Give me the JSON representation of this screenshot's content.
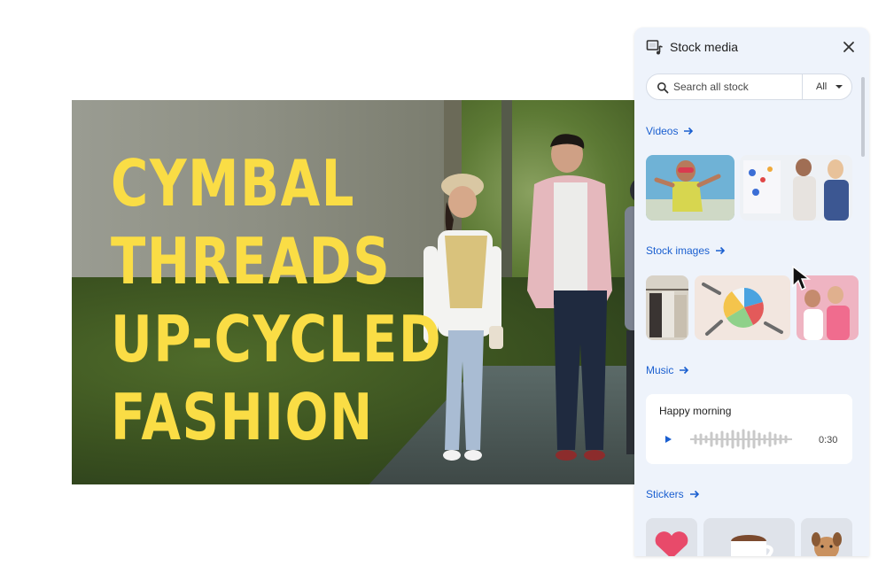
{
  "hero": {
    "title_lines": [
      "CYMBAL",
      "THREADS",
      "UP-CYCLED",
      "FASHION"
    ],
    "title_color": "#fadd45"
  },
  "panel": {
    "title": "Stock media",
    "header_icon": "stock-media-icon",
    "close_icon": "close-icon",
    "search": {
      "placeholder": "Search all stock",
      "filter_label": "All"
    },
    "sections": {
      "videos": "Videos",
      "stock_images": "Stock images",
      "music": "Music",
      "stickers": "Stickers"
    },
    "music_track": {
      "title": "Happy morning",
      "duration": "0:30"
    }
  },
  "colors": {
    "panel_bg": "#eef3fb",
    "link": "#1a5fd0"
  }
}
